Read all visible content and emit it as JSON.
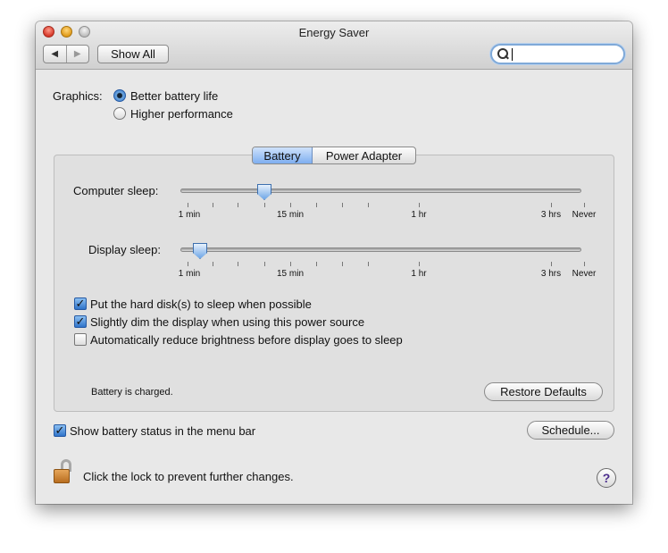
{
  "window": {
    "title": "Energy Saver",
    "show_all_label": "Show All",
    "back_glyph": "◀",
    "forward_glyph": "▶",
    "search_placeholder": ""
  },
  "graphics": {
    "label": "Graphics:",
    "options": [
      {
        "label": "Better battery life",
        "selected": true
      },
      {
        "label": "Higher performance",
        "selected": false
      }
    ]
  },
  "tabs": {
    "items": [
      "Battery",
      "Power Adapter"
    ],
    "active": "Battery"
  },
  "sliders": {
    "computer_sleep": {
      "label": "Computer sleep:",
      "value": "15 min"
    },
    "display_sleep": {
      "label": "Display sleep:",
      "value": "2 min"
    },
    "tick_labels": [
      "1 min",
      "15 min",
      "1 hr",
      "3 hrs",
      "Never"
    ]
  },
  "options": {
    "disk_sleep": {
      "label": "Put the hard disk(s) to sleep when possible",
      "checked": true
    },
    "dim_display": {
      "label": "Slightly dim the display when using this power source",
      "checked": true
    },
    "auto_brightness": {
      "label": "Automatically reduce brightness before display goes to sleep",
      "checked": false
    }
  },
  "status": {
    "battery": "Battery is charged."
  },
  "buttons": {
    "restore_defaults": "Restore Defaults",
    "schedule": "Schedule..."
  },
  "menu_bar": {
    "label": "Show battery status in the menu bar",
    "checked": true
  },
  "lock": {
    "text": "Click the lock to prevent further changes."
  },
  "help": {
    "glyph": "?"
  }
}
